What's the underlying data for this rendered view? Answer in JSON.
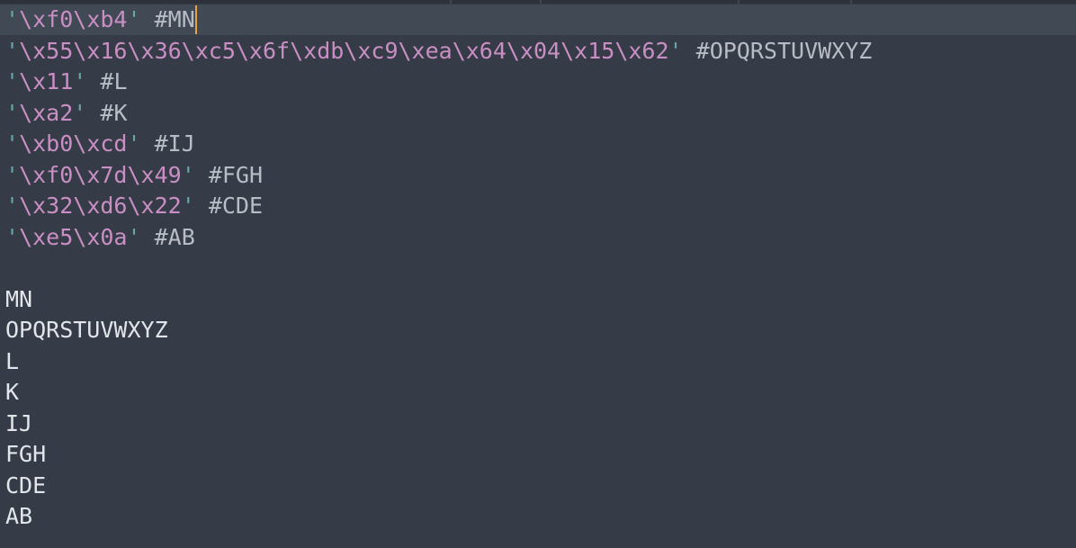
{
  "code_lines": [
    {
      "str": "\\xf0\\xb4",
      "comment": "#MN"
    },
    {
      "str": "\\x55\\x16\\x36\\xc5\\x6f\\xdb\\xc9\\xea\\x64\\x04\\x15\\x62",
      "comment": "#OPQRSTUVWXYZ"
    },
    {
      "str": "\\x11",
      "comment": "#L"
    },
    {
      "str": "\\xa2",
      "comment": "#K"
    },
    {
      "str": "\\xb0\\xcd",
      "comment": "#IJ"
    },
    {
      "str": "\\xf0\\x7d\\x49",
      "comment": "#FGH"
    },
    {
      "str": "\\x32\\xd6\\x22",
      "comment": "#CDE"
    },
    {
      "str": "\\xe5\\x0a",
      "comment": "#AB"
    }
  ],
  "output_lines": [
    "MN",
    "OPQRSTUVWXYZ",
    "L",
    "K",
    "IJ",
    "FGH",
    "CDE",
    "AB"
  ],
  "colors": {
    "background": "#363c47",
    "active_line": "#414955",
    "quote": "#6aa6a8",
    "string": "#c98fc4",
    "comment": "#b8bcc4",
    "cursor": "#e8a33d"
  }
}
